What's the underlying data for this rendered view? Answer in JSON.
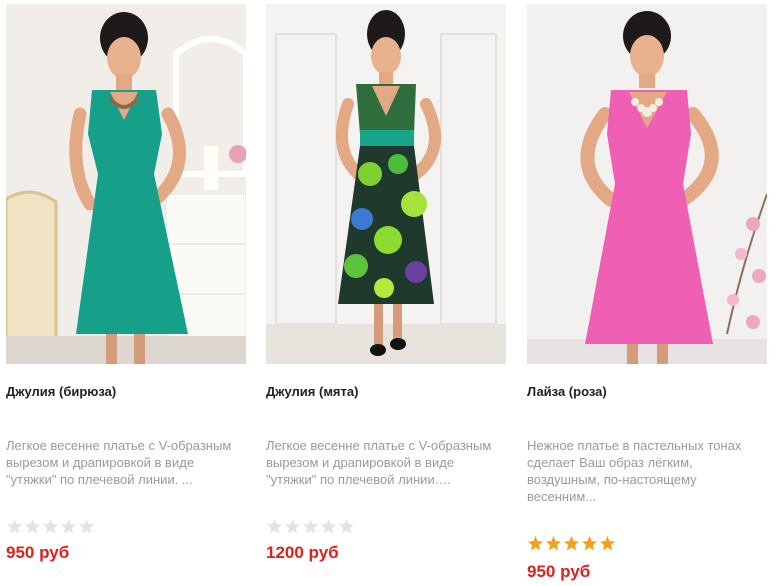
{
  "products": [
    {
      "title": "Джулия (бирюза)",
      "description": "Легкое весенне платье с V-образным вырезом и драпировкой в виде \"утяжки\" по плечевой линии. ...",
      "rating": 0,
      "price": "950 руб",
      "dress_color": "#16a08a"
    },
    {
      "title": "Джулия (мята)",
      "description": "Легкое весенне платье с V-образным вырезом и драпировкой в виде \"утяжки\" по плечевой линии.…",
      "rating": 0,
      "price": "1200 руб",
      "dress_color": "#2fa862"
    },
    {
      "title": "Лайза (роза)",
      "description": "Нежное платье в пастельных тонах сделает Ваш образ лёгким, воздушным, по-настоящему весенним...",
      "rating": 5,
      "price": "950 руб",
      "dress_color": "#ef5fb4"
    }
  ],
  "colors": {
    "price": "#e0201b",
    "star_filled": "#f6a01a",
    "star_empty": "#e3e3e3"
  }
}
